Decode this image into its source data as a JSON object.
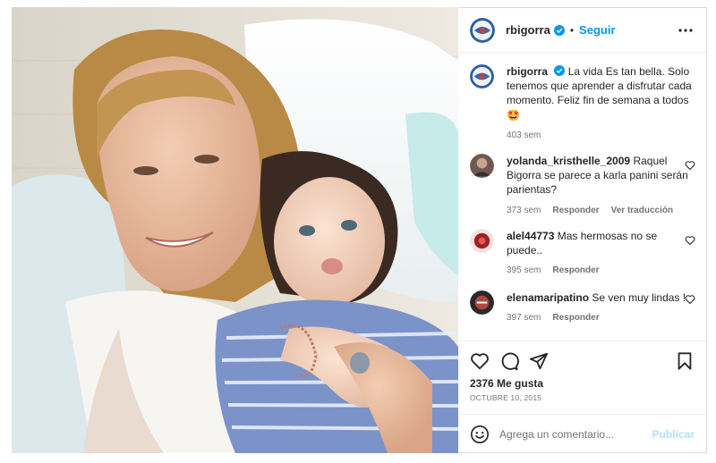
{
  "post": {
    "username": "rbigorra",
    "follow_label": "Seguir",
    "separator": "•",
    "caption": {
      "username": "rbigorra",
      "text": "La vida Es tan bella. Solo tenemos que aprender a disfrutar cada momento. Feliz fin de semana a todos 🤩",
      "time": "403 sem"
    },
    "comments": [
      {
        "username": "yolanda_kristhelle_2009",
        "text": "Raquel Bigorra se parece a karla panini serán parientas?",
        "time": "373 sem",
        "reply_label": "Responder",
        "translate_label": "Ver traducción"
      },
      {
        "username": "alel44773",
        "text": "Mas hermosas no se puede..",
        "time": "395 sem",
        "reply_label": "Responder"
      },
      {
        "username": "elenamaripatino",
        "text": "Se ven muy lindas !",
        "time": "397 sem",
        "reply_label": "Responder"
      }
    ],
    "likes_text": "2376 Me gusta",
    "date": "OCTUBRE 10, 2015",
    "composer": {
      "placeholder": "Agrega un comentario...",
      "publish_label": "Publicar"
    }
  },
  "icons": {
    "verified": "verified-badge-icon",
    "more": "more-options-icon",
    "like": "heart-icon",
    "comment": "comment-bubble-icon",
    "share": "paper-plane-icon",
    "save": "bookmark-icon",
    "emoji": "emoji-smiley-icon"
  },
  "colors": {
    "accent": "#0095f6",
    "publish_disabled": "#b2dffc",
    "text": "#262626",
    "secondary": "#737373",
    "border": "#dbdbdb"
  }
}
